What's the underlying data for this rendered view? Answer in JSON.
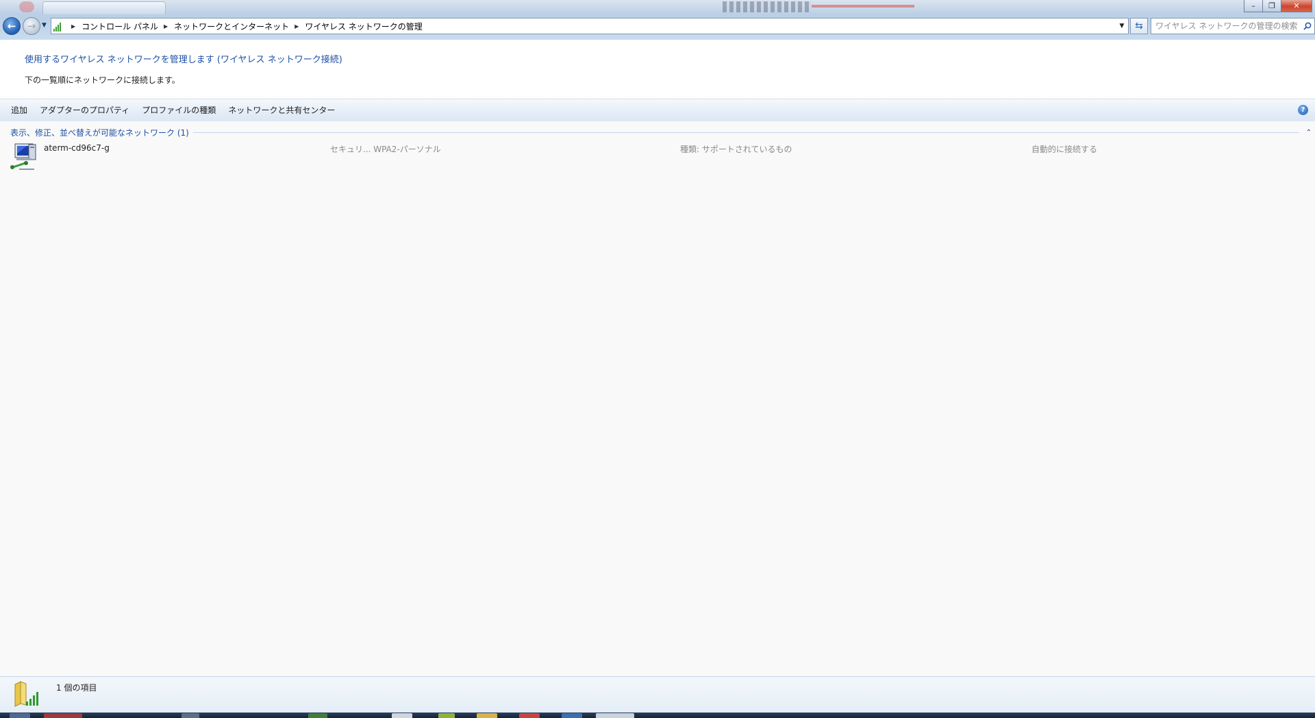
{
  "window": {
    "controls": {
      "minimize": "–",
      "maximize": "❐",
      "close": "✕"
    }
  },
  "nav": {
    "back_icon": "←",
    "forward_icon": "→",
    "history_icon": "▼"
  },
  "address": {
    "breadcrumbs": [
      "コントロール パネル",
      "ネットワークとインターネット",
      "ワイヤレス ネットワークの管理"
    ],
    "separator": "▶",
    "dropdown_icon": "▼",
    "refresh_icon": "⇆"
  },
  "search": {
    "placeholder": "ワイヤレス ネットワークの管理の検索"
  },
  "header": {
    "title_link": "使用するワイヤレス ネットワークを管理します (ワイヤレス ネットワーク接続)",
    "description": "下の一覧順にネットワークに接続します。"
  },
  "commands": {
    "add": "追加",
    "adapter_properties": "アダプターのプロパティ",
    "profile_types": "プロファイルの種類",
    "network_sharing_center": "ネットワークと共有センター",
    "help": "?"
  },
  "group": {
    "title": "表示、修正、並べ替えが可能なネットワーク (1)",
    "collapse_icon": "⌃"
  },
  "networks": [
    {
      "name": "aterm-cd96c7-g",
      "security": "セキュリ... WPA2-パーソナル",
      "type": "種類: サポートされているもの",
      "mode": "自動的に接続する"
    }
  ],
  "details": {
    "item_count": "1 個の項目"
  },
  "colors": {
    "link": "#1e4fa2",
    "accent": "#2866b5",
    "signal": "#3b9b2d"
  }
}
